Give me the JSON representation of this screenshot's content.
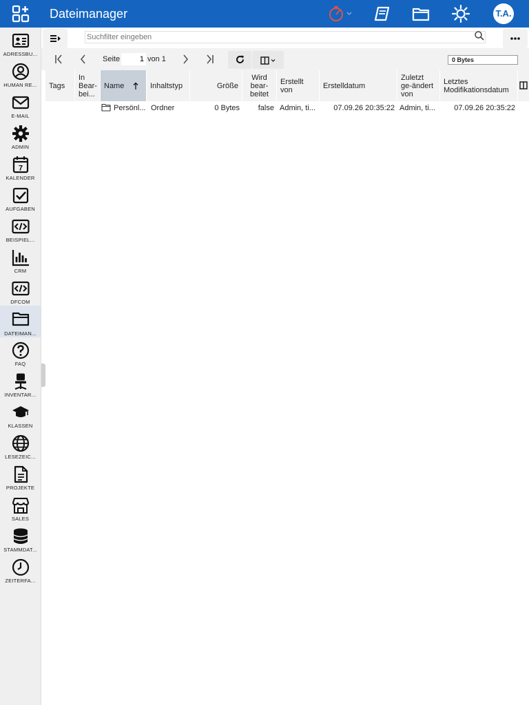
{
  "app": {
    "title": "Dateimanager",
    "avatar_initials": "T.A.",
    "accent": "#1565c0"
  },
  "sidebar": {
    "items": [
      {
        "label": "ADRESSBU...",
        "icon": "address-book-icon"
      },
      {
        "label": "HUMAN RE...",
        "icon": "person-icon"
      },
      {
        "label": "E-MAIL",
        "icon": "mail-icon"
      },
      {
        "label": "ADMIN",
        "icon": "gear-icon"
      },
      {
        "label": "KALENDER",
        "icon": "calendar-icon",
        "icon_text": "7"
      },
      {
        "label": "AUFGABEN",
        "icon": "checkbox-icon"
      },
      {
        "label": "BEISPIEL...",
        "icon": "code-icon"
      },
      {
        "label": "CRM",
        "icon": "bar-chart-icon"
      },
      {
        "label": "DFCOM",
        "icon": "code-icon"
      },
      {
        "label": "DATEIMAN...",
        "icon": "folder-icon",
        "active": true
      },
      {
        "label": "FAQ",
        "icon": "question-icon"
      },
      {
        "label": "INVENTAR...",
        "icon": "office-chair-icon"
      },
      {
        "label": "KLASSEN",
        "icon": "graduation-cap-icon"
      },
      {
        "label": "LESEZEIC...",
        "icon": "globe-icon"
      },
      {
        "label": "PROJEKTE",
        "icon": "document-icon"
      },
      {
        "label": "SALES",
        "icon": "store-icon"
      },
      {
        "label": "STAMMDAT...",
        "icon": "database-icon"
      },
      {
        "label": "ZEITERFA...",
        "icon": "clock-icon"
      }
    ]
  },
  "toolbar": {
    "search_placeholder": "Suchfilter eingeben"
  },
  "pager": {
    "page_label": "Seite",
    "page_value": "1",
    "of_label": "von 1",
    "size_total": "0 Bytes"
  },
  "table": {
    "columns": [
      {
        "label": "Tags"
      },
      {
        "label": "In Bear-bei..."
      },
      {
        "label": "Name",
        "sorted": "asc"
      },
      {
        "label": "Inhaltstyp"
      },
      {
        "label": "Größe"
      },
      {
        "label": "Wird bear-beitet"
      },
      {
        "label": "Erstellt von"
      },
      {
        "label": "Erstelldatum"
      },
      {
        "label": "Zuletzt ge-ändert von"
      },
      {
        "label": "Letztes Modifikationsdatum"
      }
    ],
    "rows": [
      {
        "tags": "",
        "in_edit": "",
        "name": "Persönl...",
        "type": "Ordner",
        "size": "0 Bytes",
        "editing": "false",
        "created_by": "Admin, ti...",
        "created": "07.09.26 20:35:22",
        "modified_by": "Admin, ti...",
        "modified": "07.09.26 20:35:22"
      }
    ]
  }
}
